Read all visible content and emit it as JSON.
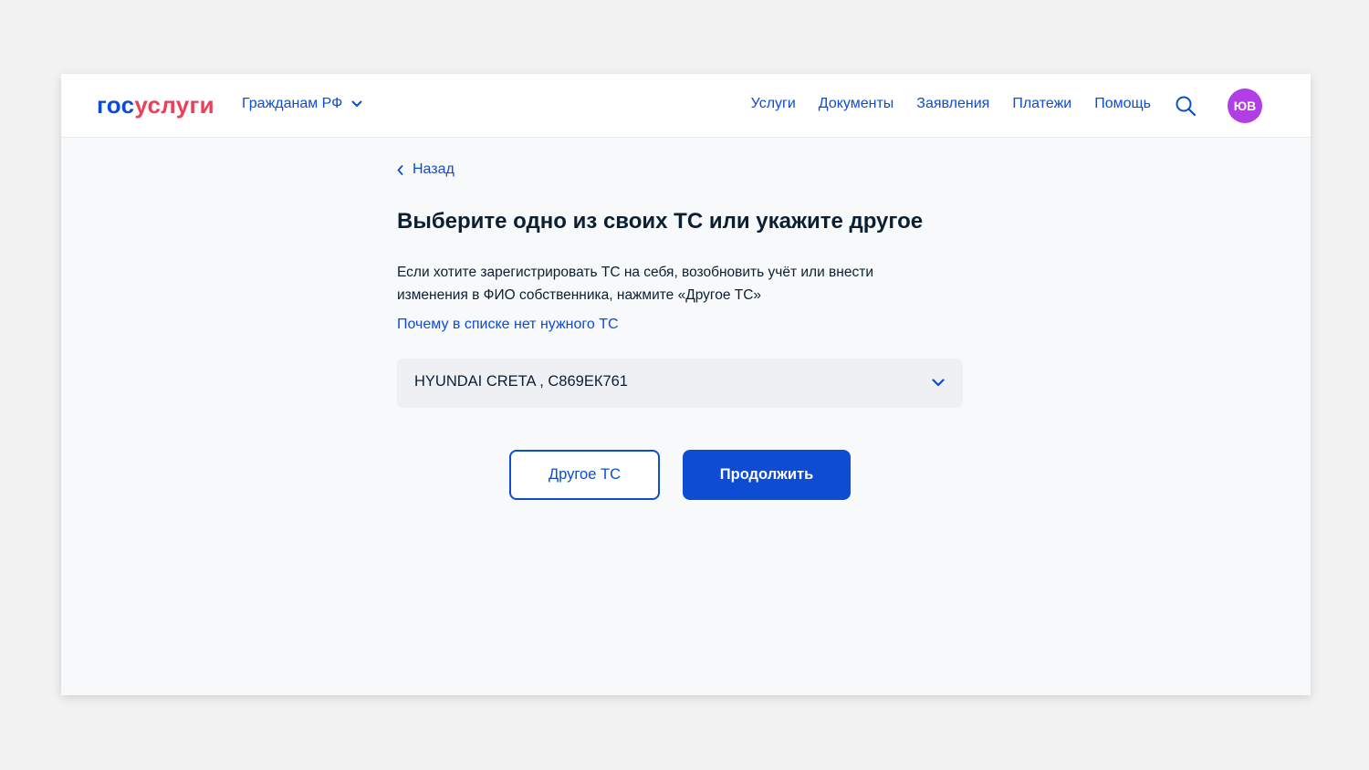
{
  "header": {
    "logo_part1": "гос",
    "logo_part2": "услуги",
    "region_label": "Гражданам РФ",
    "nav": [
      "Услуги",
      "Документы",
      "Заявления",
      "Платежи",
      "Помощь"
    ],
    "avatar_initials": "ЮВ"
  },
  "main": {
    "back_label": "Назад",
    "title": "Выберите одно из своих ТС или укажите другое",
    "description": "Если хотите зарегистрировать ТС на себя, возобновить учёт или внести изменения в ФИО собственника, нажмите «Другое ТС»",
    "why_link": "Почему в списке нет нужного ТС",
    "vehicle_select_value": "HYUNDAI CRETA , С869ЕК761",
    "other_button": "Другое ТС",
    "continue_button": "Продолжить"
  },
  "colors": {
    "brand_blue": "#0d4cd3",
    "brand_red": "#ee3f58",
    "avatar": "#b23ee6"
  },
  "icons": [
    "chevron-down-icon",
    "search-icon",
    "chevron-left-icon"
  ]
}
